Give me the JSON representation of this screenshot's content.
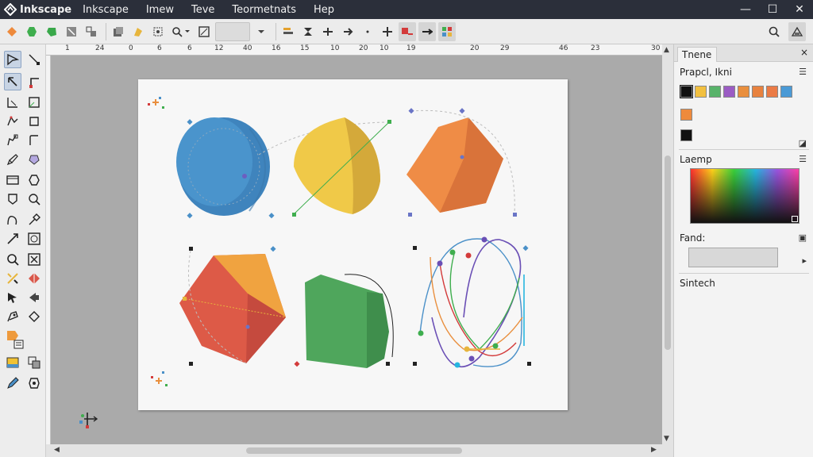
{
  "titlebar": {
    "app_title": "Inkscape",
    "menu": [
      "Inkscape",
      "Imew",
      "Teve",
      "Teormetnats",
      "Hep"
    ],
    "controls": {
      "minimize": "—",
      "maximize": "☐",
      "close": "✕"
    }
  },
  "ruler": {
    "labels": [
      "1",
      "24",
      "0",
      "6",
      "6",
      "12",
      "40",
      "16",
      "15",
      "10",
      "20",
      "10",
      "19",
      "20",
      "29",
      "46",
      "23",
      "30"
    ]
  },
  "dock": {
    "tab_label": "Tnene",
    "close_label": "×",
    "swatches_title": "Prapcl, Ikni",
    "swatch_colors": [
      "#111111",
      "#f2c040",
      "#58b36a",
      "#9b5cc4",
      "#e98f3e",
      "#e8823f",
      "#eb7b46",
      "#4a9ad6"
    ],
    "recent_colors": [
      "#ee8a3c",
      "#111111"
    ],
    "gradient_title": "Laemp",
    "fill_label": "Fand:",
    "stroke_title": "Sintech"
  },
  "colors": {
    "titlebar_bg": "#2b2f3a",
    "canvas_bg": "#aaaaaa",
    "circle": "#4a90c8",
    "yellow_shape": "#ecc545",
    "orange_hex": "#e8843f",
    "red_pentagon": "#d9574a",
    "green_box": "#4fa55c"
  }
}
